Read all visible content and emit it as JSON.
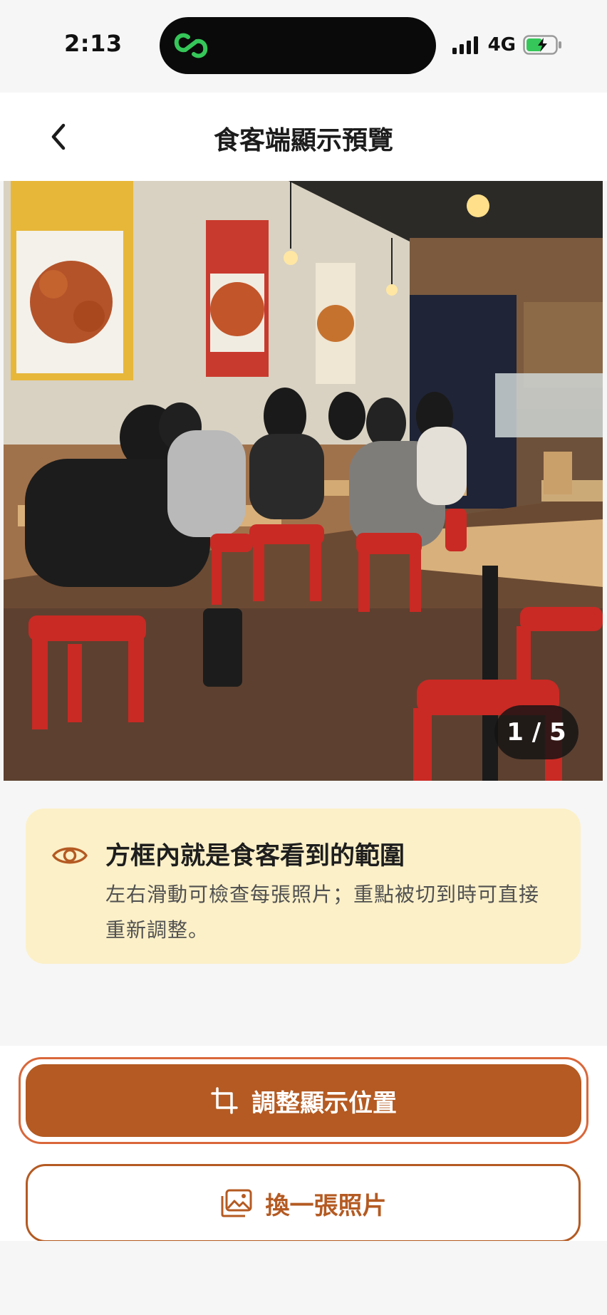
{
  "status_bar": {
    "time": "2:13",
    "network": "4G",
    "battery_state": "charging",
    "signal_bars": 4,
    "app_link_icon": "link-chain-icon",
    "colors": {
      "app_link": "#35c759",
      "battery": "#35c759"
    }
  },
  "header": {
    "title": "食客端顯示預覽",
    "back_icon": "chevron-left-icon"
  },
  "photo": {
    "page_indicator": "1 / 5",
    "current_index": 1,
    "total": 5
  },
  "info_card": {
    "icon": "eye-icon",
    "title": "方框內就是食客看到的範圍",
    "body": "左右滑動可檢查每張照片；重點被切到時可直接重新調整。",
    "colors": {
      "background": "#fcf0c8",
      "icon": "#b45a22"
    }
  },
  "actions": {
    "adjust_label": "調整顯示位置",
    "adjust_icon": "crop-icon",
    "replace_label": "換一張照片",
    "replace_icon": "image-icon",
    "colors": {
      "primary": "#b45a22",
      "primary_outline": "#d9673a"
    }
  }
}
